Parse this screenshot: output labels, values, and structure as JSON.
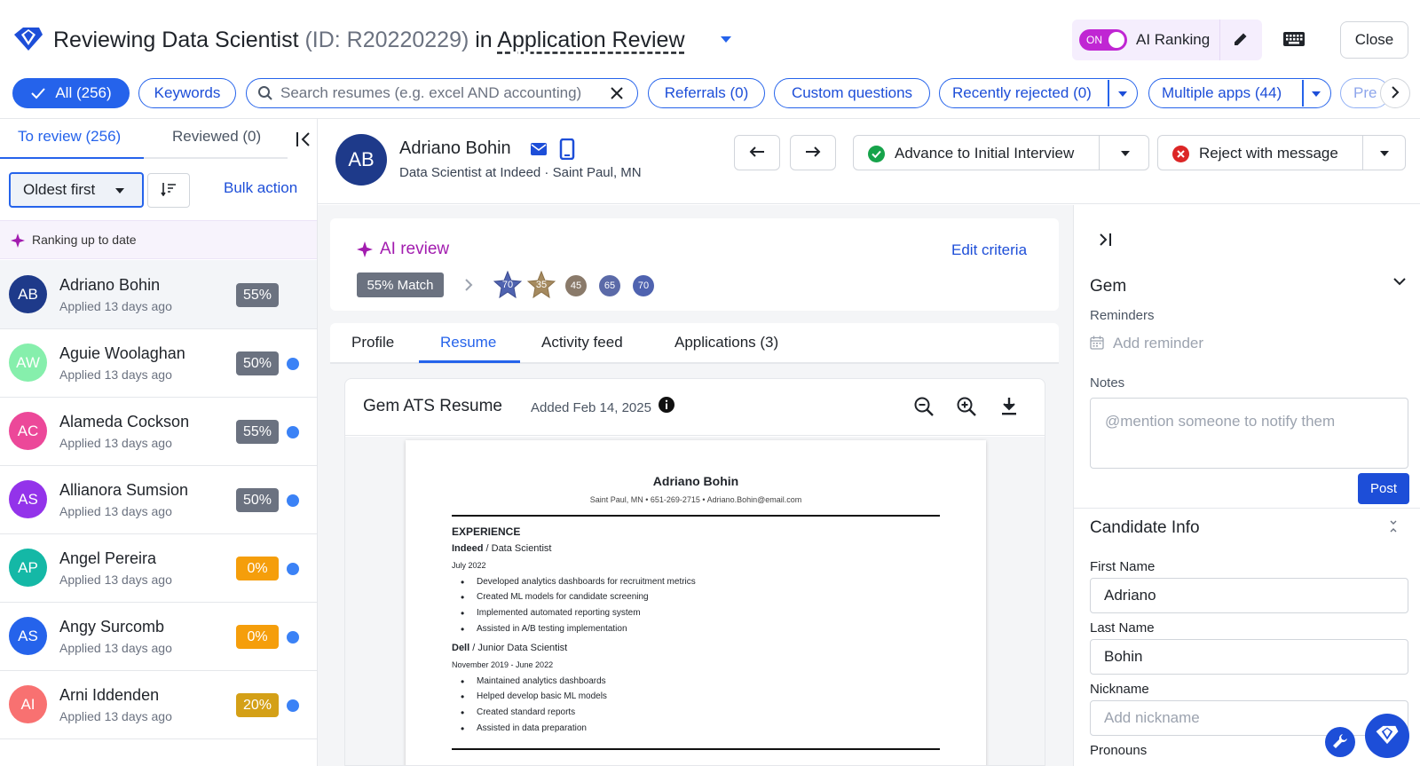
{
  "header": {
    "title_prefix": "Reviewing Data Scientist",
    "title_id": "(ID: R20220229)",
    "title_in": "in",
    "stage": "Application Review",
    "toggle_state": "ON",
    "ai_ranking_label": "AI Ranking",
    "close_label": "Close"
  },
  "filters": {
    "all": "All (256)",
    "keywords": "Keywords",
    "search_placeholder": "Search resumes (e.g. excel AND accounting)",
    "referrals": "Referrals (0)",
    "custom_questions": "Custom questions",
    "recently_rejected": "Recently rejected (0)",
    "multiple_apps": "Multiple apps (44)",
    "truncated": "Pre"
  },
  "left": {
    "tab_to_review": "To review (256)",
    "tab_reviewed": "Reviewed (0)",
    "sort_label": "Oldest first",
    "bulk_action": "Bulk action",
    "ranking_status": "Ranking up to date",
    "candidates": [
      {
        "initials": "AB",
        "name": "Adriano Bohin",
        "applied": "Applied 13 days ago",
        "score": "55%",
        "avatar_color": "#1e3a8a",
        "score_color": "#6b7280",
        "unread": false
      },
      {
        "initials": "AW",
        "name": "Aguie Woolaghan",
        "applied": "Applied 13 days ago",
        "score": "50%",
        "avatar_color": "#86efac",
        "score_color": "#6b7280",
        "unread": true
      },
      {
        "initials": "AC",
        "name": "Alameda Cockson",
        "applied": "Applied 13 days ago",
        "score": "55%",
        "avatar_color": "#ec4899",
        "score_color": "#6b7280",
        "unread": true
      },
      {
        "initials": "AS",
        "name": "Allianora Sumsion",
        "applied": "Applied 13 days ago",
        "score": "50%",
        "avatar_color": "#9333ea",
        "score_color": "#6b7280",
        "unread": true
      },
      {
        "initials": "AP",
        "name": "Angel Pereira",
        "applied": "Applied 13 days ago",
        "score": "0%",
        "avatar_color": "#14b8a6",
        "score_color": "#f59e0b",
        "unread": true
      },
      {
        "initials": "AS",
        "name": "Angy Surcomb",
        "applied": "Applied 13 days ago",
        "score": "0%",
        "avatar_color": "#2563eb",
        "score_color": "#f59e0b",
        "unread": true
      },
      {
        "initials": "AI",
        "name": "Arni Iddenden",
        "applied": "Applied 13 days ago",
        "score": "20%",
        "avatar_color": "#f87171",
        "score_color": "#d4a017",
        "unread": true
      }
    ]
  },
  "candidate": {
    "initials": "AB",
    "name": "Adriano Bohin",
    "subtitle": "Data Scientist at Indeed · Saint Paul, MN",
    "advance_label": "Advance to Initial Interview",
    "reject_label": "Reject with message"
  },
  "ai_review": {
    "title": "AI review",
    "edit_criteria": "Edit criteria",
    "match": "55% Match",
    "criteria": [
      "70",
      "35",
      "45",
      "65",
      "70"
    ]
  },
  "tabs": [
    "Profile",
    "Resume",
    "Activity feed",
    "Applications (3)"
  ],
  "resume": {
    "title": "Gem ATS Resume",
    "added": "Added Feb 14, 2025",
    "doc": {
      "name": "Adriano Bohin",
      "contact": "Saint Paul, MN  • 651-269-2715  • Adriano.Bohin@email.com",
      "section": "EXPERIENCE",
      "job1_company": "Indeed",
      "job1_title": " / Data Scientist",
      "job1_date": "July 2022",
      "job1_bullets": [
        "Developed analytics dashboards for recruitment metrics",
        "Created ML models for candidate screening",
        "Implemented automated reporting system",
        "Assisted in A/B testing implementation"
      ],
      "job2_company": "Dell",
      "job2_title": " / Junior Data Scientist",
      "job2_date": "November 2019 - June 2022",
      "job2_bullets": [
        "Maintained analytics dashboards",
        "Helped develop basic ML models",
        "Created standard reports",
        "Assisted in data preparation"
      ]
    }
  },
  "right": {
    "section_gem": "Gem",
    "reminders_label": "Reminders",
    "add_reminder": "Add reminder",
    "notes_label": "Notes",
    "notes_placeholder": "@mention someone to notify them",
    "post_label": "Post",
    "candidate_info": "Candidate Info",
    "first_name_label": "First Name",
    "first_name": "Adriano",
    "last_name_label": "Last Name",
    "last_name": "Bohin",
    "nickname_label": "Nickname",
    "nickname_placeholder": "Add nickname",
    "pronouns_label": "Pronouns"
  }
}
